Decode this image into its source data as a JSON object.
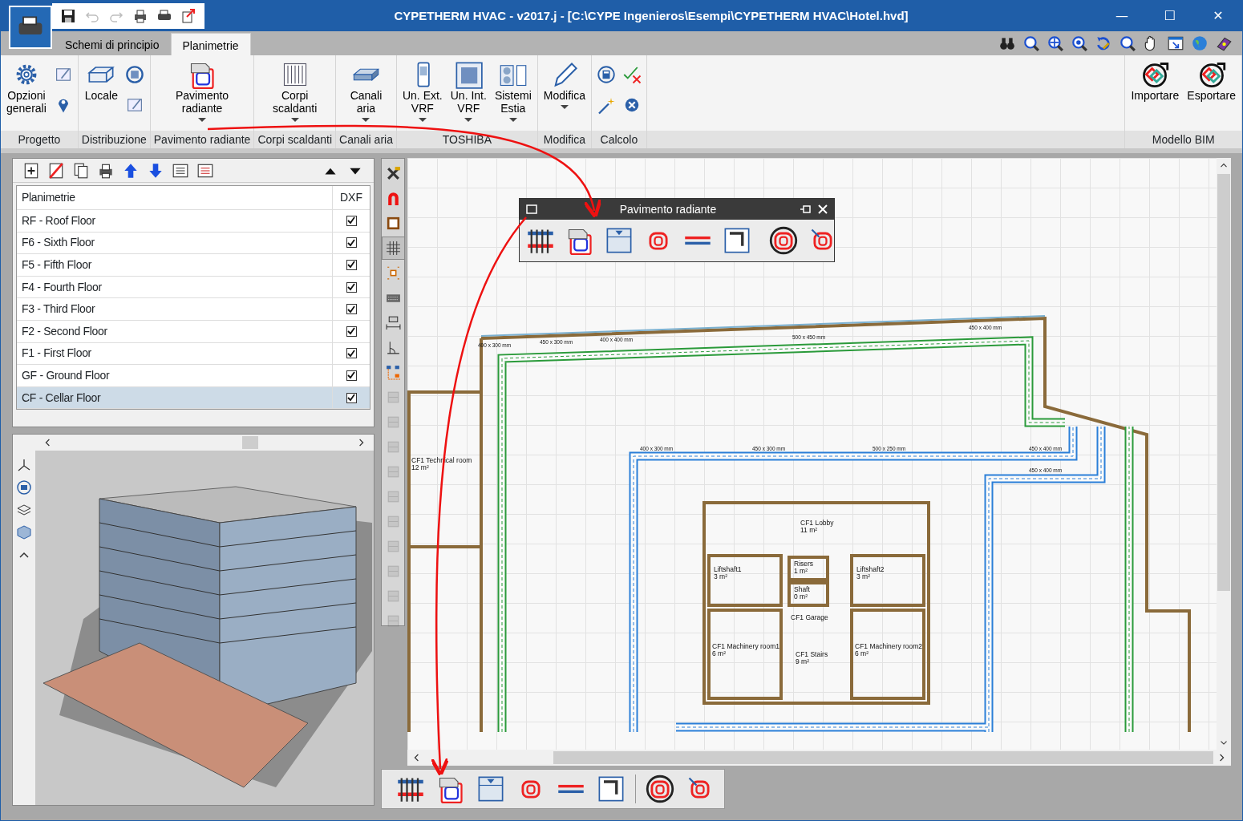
{
  "window": {
    "title": "CYPETHERM HVAC - v2017.j - [C:\\CYPE Ingenieros\\Esempi\\CYPETHERM HVAC\\Hotel.hvd]",
    "controls": [
      "—",
      "☐",
      "✕"
    ]
  },
  "quick_access": [
    {
      "disabled": false
    },
    {
      "disabled": true
    },
    {
      "disabled": true
    },
    {
      "disabled": false
    },
    {
      "disabled": false
    },
    {
      "disabled": false
    }
  ],
  "tabs": [
    {
      "label": "Schemi di principio",
      "selected": false
    },
    {
      "label": "Planimetrie",
      "selected": true
    }
  ],
  "ribbon_groups": [
    {
      "label": "Progetto",
      "buttons": [
        {
          "label": "Opzioni\ngenerali",
          "dropdown": false
        }
      ]
    },
    {
      "label": "Distribuzione",
      "buttons": [
        {
          "label": "Locale",
          "dropdown": false
        }
      ]
    },
    {
      "label": "Pavimento radiante",
      "buttons": [
        {
          "label": "Pavimento\nradiante",
          "dropdown": true
        }
      ]
    },
    {
      "label": "Corpi scaldanti",
      "buttons": [
        {
          "label": "Corpi\nscaldanti",
          "dropdown": true
        }
      ]
    },
    {
      "label": "Canali aria",
      "buttons": [
        {
          "label": "Canali\naria",
          "dropdown": true
        }
      ]
    },
    {
      "label": "TOSHIBA",
      "buttons": [
        {
          "label": "Un. Ext.\nVRF",
          "dropdown": true
        },
        {
          "label": "Un. Int.\nVRF",
          "dropdown": true
        },
        {
          "label": "Sistemi\nEstia",
          "dropdown": true
        }
      ]
    },
    {
      "label": "Modifica",
      "buttons": [
        {
          "label": "Modifica",
          "dropdown": true
        }
      ]
    },
    {
      "label": "Calcolo"
    },
    {
      "label": "Modello BIM",
      "buttons": [
        {
          "label": "Importare",
          "dropdown": false
        },
        {
          "label": "Esportare",
          "dropdown": false
        }
      ]
    }
  ],
  "floors_table": {
    "columns": [
      "Planimetrie",
      "DXF"
    ],
    "rows": [
      {
        "label": "RF - Roof Floor",
        "checked": true,
        "selected": false
      },
      {
        "label": "F6 - Sixth Floor",
        "checked": true,
        "selected": false
      },
      {
        "label": "F5 - Fifth Floor",
        "checked": true,
        "selected": false
      },
      {
        "label": "F4 - Fourth Floor",
        "checked": true,
        "selected": false
      },
      {
        "label": "F3 - Third Floor",
        "checked": true,
        "selected": false
      },
      {
        "label": "F2 - Second Floor",
        "checked": true,
        "selected": false
      },
      {
        "label": "F1 - First Floor",
        "checked": true,
        "selected": false
      },
      {
        "label": "GF - Ground Floor",
        "checked": true,
        "selected": false
      },
      {
        "label": "CF - Cellar Floor",
        "checked": true,
        "selected": true
      }
    ]
  },
  "drawing_toolbar": [
    {
      "selected": false,
      "disabled": false
    },
    {
      "selected": false,
      "disabled": false
    },
    {
      "selected": false,
      "disabled": false
    },
    {
      "selected": true,
      "disabled": false
    },
    {
      "selected": false,
      "disabled": false
    },
    {
      "selected": false,
      "disabled": false
    },
    {
      "selected": false,
      "disabled": false
    },
    {
      "selected": false,
      "disabled": false
    },
    {
      "selected": false,
      "disabled": false
    },
    {
      "selected": false,
      "disabled": true
    },
    {
      "selected": false,
      "disabled": true
    },
    {
      "selected": false,
      "disabled": true
    },
    {
      "selected": false,
      "disabled": true
    },
    {
      "selected": false,
      "disabled": true
    },
    {
      "selected": false,
      "disabled": true
    },
    {
      "selected": false,
      "disabled": true
    },
    {
      "selected": false,
      "disabled": true
    },
    {
      "selected": false,
      "disabled": true
    },
    {
      "selected": false,
      "disabled": true
    }
  ],
  "floor_plan": {
    "rooms": [
      {
        "name": "CF1 Technical room",
        "area": "12 m²"
      },
      {
        "name": "CF1 Lobby",
        "area": "11 m²"
      },
      {
        "name": "Risers",
        "area": "1 m²"
      },
      {
        "name": "Liftshaft1",
        "area": "3 m²"
      },
      {
        "name": "Shaft",
        "area": "0 m²"
      },
      {
        "name": "Liftshaft2",
        "area": "3 m²"
      },
      {
        "name": "CF1 Garage"
      },
      {
        "name": "CF1 Stairs",
        "area": "9 m²"
      },
      {
        "name": "CF1 Machinery room1",
        "area": "6 m²"
      },
      {
        "name": "CF1 Machinery room2",
        "area": "6 m²"
      }
    ],
    "duct_labels": [
      "450 x 400 mm",
      "400 x 300 mm",
      "450 x 300 mm",
      "400 x 400 mm",
      "500 x 450 mm",
      "400 x 300 mm",
      "450 x 300 mm",
      "500 x 250 mm",
      "450 x 400 mm",
      "450 x 400 mm"
    ]
  },
  "floating_toolbar": {
    "title": "Pavimento radiante"
  }
}
